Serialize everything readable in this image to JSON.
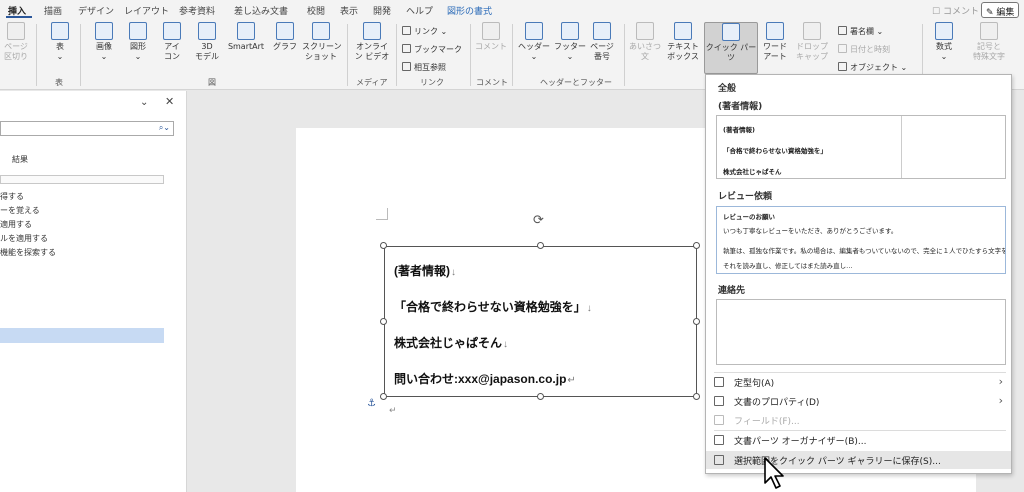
{
  "tabs": {
    "items": [
      "挿入",
      "描画",
      "デザイン",
      "レイアウト",
      "参考資料",
      "差し込み文書",
      "校閲",
      "表示",
      "開発",
      "ヘルプ",
      "図形の書式"
    ],
    "comment_label": "コメント",
    "edit_label": "編集"
  },
  "ribbon": {
    "page_break": "ページ\n区切り",
    "table": "表",
    "image": "画像",
    "shapes": "図形",
    "icons": "アイ\nコン",
    "model3d": "3D\nモデル",
    "smartart": "SmartArt",
    "graph": "グラフ",
    "screenshot": "スクリーン\nショット",
    "online_video": "オンライ\nン ビデオ",
    "link": "リンク",
    "bookmark": "ブックマーク",
    "cross_ref": "相互参照",
    "comment": "コメント",
    "header": "ヘッダー",
    "footer": "フッター",
    "page_number": "ページ\n番号",
    "greeting": "あいさつ\n文",
    "textbox": "テキスト\nボックス",
    "quick_parts": "クイック パーツ",
    "wordart": "ワード\nアート",
    "dropcap": "ドロップ\nキャップ",
    "signature_line": "署名欄",
    "date_time": "日付と時刻",
    "object": "オブジェクト",
    "equation": "数式",
    "symbol": "記号と\n特殊文字",
    "groups": {
      "table": "表",
      "illustrations": "図",
      "media": "メディア",
      "links": "リンク",
      "comments": "コメント",
      "header_footer": "ヘッダーとフッター"
    }
  },
  "navpane": {
    "results_label": "結果",
    "items": [
      "得する",
      "ーを覚える",
      "適用する",
      "ルを適用する",
      "機能を探索する"
    ]
  },
  "textbox": {
    "lines": [
      "(著者情報)",
      "「合格で終わらせない資格勉強を」",
      "株式会社じゃぱそん",
      "問い合わせ:xxx@japason.co.jp"
    ]
  },
  "dropdown": {
    "header": "全般",
    "entries": [
      {
        "title": "(著者情報)",
        "preview": [
          "(著者情報)",
          "「合格で終わらせない資格勉強を」",
          "株式会社じゃぱそん"
        ]
      },
      {
        "title": "レビュー依頼",
        "preview": [
          "レビューのお願い",
          "いつも丁寧なレビューをいただき、ありがとうございます。",
          "執筆は、孤独な作業です。私の場合は、編集者もついていないので、完全に１人でひたすら文字を打ち込み、",
          "それを読み直し、修正してはまた読み直し…"
        ]
      },
      {
        "title": "連絡先",
        "preview": []
      }
    ],
    "menu": [
      {
        "label": "定型句(A)",
        "arrow": "›"
      },
      {
        "label": "文書のプロパティ(D)",
        "arrow": "›"
      },
      {
        "label": "フィールド(F)...",
        "arrow": ""
      },
      {
        "label": "文書パーツ オーガナイザー(B)...",
        "arrow": ""
      },
      {
        "label": "選択範囲をクイック パーツ ギャラリーに保存(S)...",
        "arrow": ""
      }
    ]
  }
}
